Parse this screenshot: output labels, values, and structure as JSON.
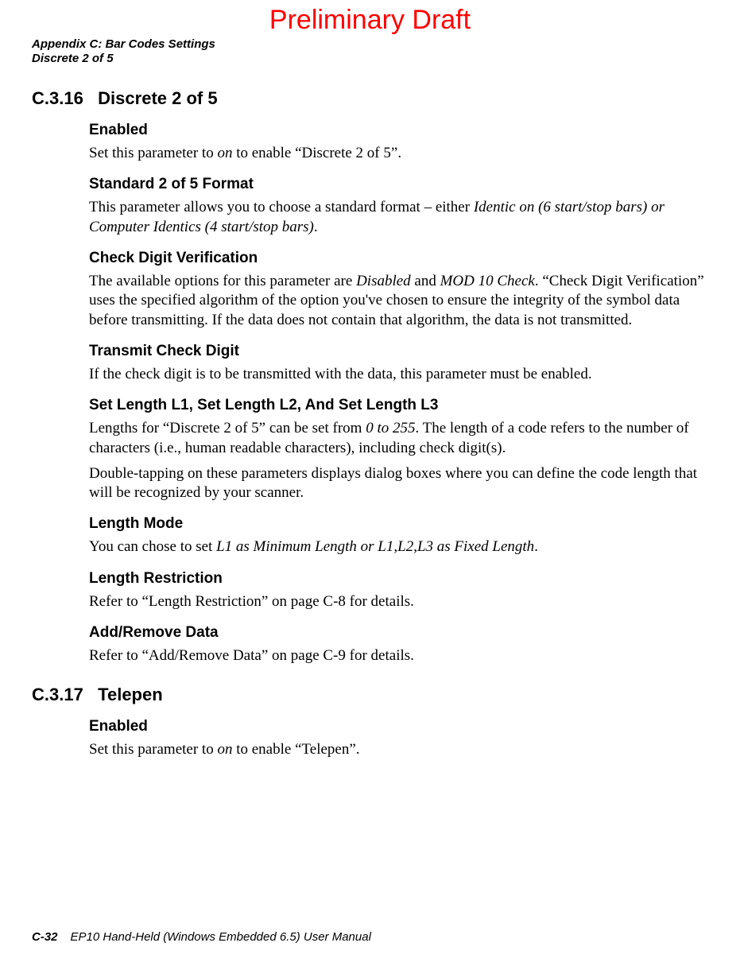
{
  "watermark": "Preliminary Draft",
  "running_head": {
    "line1": "Appendix C: Bar Codes Settings",
    "line2": "Discrete 2 of 5"
  },
  "sections": {
    "s1": {
      "number": "C.3.16",
      "title": "Discrete 2 of 5",
      "enabled": {
        "heading": "Enabled",
        "text_a": "Set this parameter to ",
        "text_em": "on",
        "text_b": " to enable “Discrete 2 of 5”."
      },
      "standard": {
        "heading": "Standard 2 of 5 Format",
        "text_a": "This parameter allows you to choose a standard format – either ",
        "text_em": "Identic on (6 start/stop bars) or Computer Identics (4 start/stop bars)",
        "text_b": "."
      },
      "checkdigit": {
        "heading": "Check Digit Verification",
        "text_a": "The available options for this parameter are ",
        "em1": "Disabled",
        "text_b": " and ",
        "em2": "MOD 10 Check",
        "text_c": ". “Check Digit Verification” uses the specified algorithm of the option you've chosen to ensure the integrity of the symbol data before transmitting. If the data does not contain that algorithm, the data is not transmitted."
      },
      "transmit": {
        "heading": "Transmit Check Digit",
        "text": "If the check digit is to be transmitted with the data, this parameter must be enabled."
      },
      "setlength": {
        "heading": "Set Length L1, Set Length L2, And Set Length L3",
        "p1_a": "Lengths for “Discrete 2 of 5” can be set from ",
        "p1_em": "0 to 255",
        "p1_b": ". The length of a code refers to the number of characters (i.e., human readable characters), including check digit(s).",
        "p2": "Double-tapping on these parameters displays dialog boxes where you can define the code length that will be recognized by your scanner."
      },
      "lengthmode": {
        "heading": "Length Mode",
        "text_a": "You can chose to set ",
        "text_em": "L1 as Minimum Length or L1,L2,L3 as Fixed Length",
        "text_b": "."
      },
      "lengthrestrict": {
        "heading": "Length Restriction",
        "text": "Refer to “Length Restriction” on page C-8 for details."
      },
      "addremove": {
        "heading": "Add/Remove Data",
        "text": "Refer to “Add/Remove Data” on page C-9 for details."
      }
    },
    "s2": {
      "number": "C.3.17",
      "title": "Telepen",
      "enabled": {
        "heading": "Enabled",
        "text_a": "Set this parameter to ",
        "text_em": "on",
        "text_b": " to enable “Telepen”."
      }
    }
  },
  "footer": {
    "page": "C-32",
    "title": "EP10 Hand-Held (Windows Embedded 6.5) User Manual"
  }
}
